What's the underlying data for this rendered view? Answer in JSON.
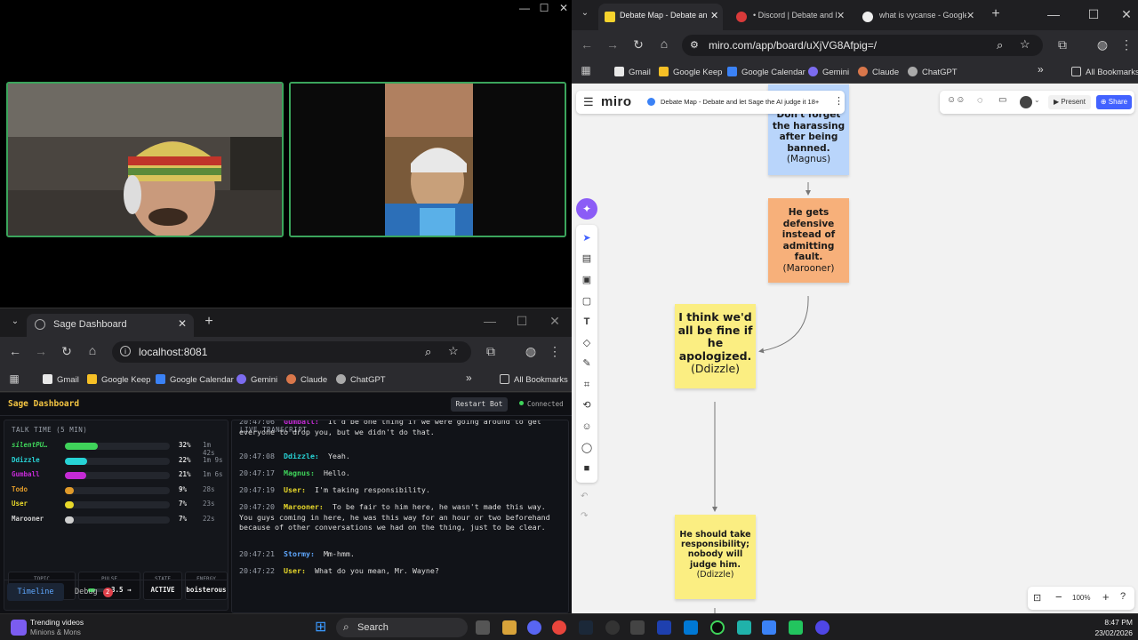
{
  "call": {
    "controls": [
      "—",
      "☐",
      "✕"
    ]
  },
  "sage_browser": {
    "tab_title": "Sage Dashboard",
    "url": "localhost:8081",
    "bookmarks": [
      "Gmail",
      "Google Keep",
      "Google Calendar",
      "Gemini",
      "Claude",
      "ChatGPT"
    ],
    "all_bookmarks": "All Bookmarks"
  },
  "dashboard": {
    "title": "Sage Dashboard",
    "restart_label": "Restart Bot",
    "status": "Connected",
    "talk_time_header": "TALK TIME (5 MIN)",
    "speakers": [
      {
        "name": "silentPU…",
        "pct": 32,
        "pct_label": "32%",
        "time": "1m 42s",
        "color": "#3fd35a"
      },
      {
        "name": "Ddizzle",
        "pct": 22,
        "pct_label": "22%",
        "time": "1m 9s",
        "color": "#27d3d6"
      },
      {
        "name": "Gumball",
        "pct": 21,
        "pct_label": "21%",
        "time": "1m 6s",
        "color": "#c52ad6"
      },
      {
        "name": "Todo",
        "pct": 9,
        "pct_label": "9%",
        "time": "28s",
        "color": "#e09a2a"
      },
      {
        "name": "User",
        "pct": 7,
        "pct_label": "7%",
        "time": "23s",
        "color": "#e8d82a"
      },
      {
        "name": "Marooner",
        "pct": 7,
        "pct_label": "7%",
        "time": "22s",
        "color": "#cfcfcf"
      }
    ],
    "stats": {
      "topic_label": "TOPIC",
      "topic_value": "-",
      "pulse_label": "PULSE",
      "pulse_value": "3.5 →",
      "pulse_level": 0.35,
      "state_label": "STATE",
      "state_value": "ACTIVE",
      "energy_label": "ENERGY",
      "energy_value": "boisterous"
    },
    "timeline_tab": "Timeline",
    "debug_tab": "Debug",
    "debug_count": "2",
    "live_header": "LIVE TRANSCRIPT",
    "transcript": [
      {
        "time": "20:47:06",
        "speaker": "Gumball:",
        "color": "#c52ad6",
        "text": "It'd be one thing if we were going around to get everyone to drop you, but we didn't do that."
      },
      {
        "time": "20:47:08",
        "speaker": "Ddizzle:",
        "color": "#27d3d6",
        "text": "Yeah."
      },
      {
        "time": "20:47:17",
        "speaker": "Magnus:",
        "color": "#3fd35a",
        "text": "Hello."
      },
      {
        "time": "20:47:19",
        "speaker": "User:",
        "color": "#e8d82a",
        "text": "I'm taking responsibility."
      },
      {
        "time": "20:47:20",
        "speaker": "Marooner:",
        "color": "#e8d82a",
        "text": "To be fair to him here, he wasn't made this way. You guys coming in here, he was this way for an hour or two beforehand because of other conversations we had on the thing, just to be clear."
      },
      {
        "time": "20:47:21",
        "speaker": "Stormy:",
        "color": "#5fa8ff",
        "text": "Mm-hmm."
      },
      {
        "time": "20:47:22",
        "speaker": "User:",
        "color": "#e8d82a",
        "text": "What do you mean, Mr. Wayne?"
      }
    ]
  },
  "right_browser": {
    "tabs": [
      "Debate Map - Debate an",
      "• Discord | Debate and l",
      "what is vycanse - Google"
    ],
    "url": "miro.com/app/board/uXjVG8Afpig=/",
    "bookmarks": [
      "Gmail",
      "Google Keep",
      "Google Calendar",
      "Gemini",
      "Claude",
      "ChatGPT"
    ],
    "all_bookmarks": "All Bookmarks"
  },
  "miro": {
    "logo": "miro",
    "board_title": "Debate Map - Debate and let Sage the AI judge it 18+",
    "present": "Present",
    "share": "Share",
    "zoom": "100%",
    "stickies": [
      {
        "text": "Don't forget the harassing after being banned.",
        "author": "(Magnus)",
        "color": "#b9d5fb"
      },
      {
        "text": "He gets defensive instead of admitting fault.",
        "author": "(Marooner)",
        "color": "#f7b07a"
      },
      {
        "text": "I think we'd all be fine if he apologized.",
        "author": "(Ddizzle)",
        "color": "#fbee82"
      },
      {
        "text": "He should take responsibility; nobody will judge him.",
        "author": "(Ddizzle)",
        "color": "#fbee82"
      }
    ]
  },
  "taskbar": {
    "trending_title": "Trending videos",
    "trending_sub": "Minions & Mons",
    "search": "Search",
    "time": "8:47 PM",
    "date": "23/02/2026"
  }
}
